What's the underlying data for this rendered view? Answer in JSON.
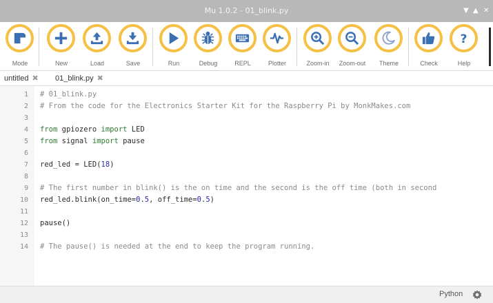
{
  "window": {
    "title": "Mu 1.0.2 - 01_blink.py"
  },
  "toolbar": {
    "buttons": [
      {
        "label": "Mode"
      },
      {
        "label": "New"
      },
      {
        "label": "Load"
      },
      {
        "label": "Save"
      },
      {
        "label": "Run"
      },
      {
        "label": "Debug"
      },
      {
        "label": "REPL"
      },
      {
        "label": "Plotter"
      },
      {
        "label": "Zoom-in"
      },
      {
        "label": "Zoom-out"
      },
      {
        "label": "Theme"
      },
      {
        "label": "Check"
      },
      {
        "label": "Help"
      }
    ]
  },
  "tabs": [
    {
      "label": "untitled"
    },
    {
      "label": "01_blink.py"
    }
  ],
  "editor": {
    "lines": [
      {
        "num": "1",
        "code": "# 01_blink.py"
      },
      {
        "num": "2",
        "code": "# From the code for the Electronics Starter Kit for the Raspberry Pi by MonkMakes.com"
      },
      {
        "num": "3",
        "code": ""
      },
      {
        "num": "4",
        "code": "from gpiozero import LED"
      },
      {
        "num": "5",
        "code": "from signal import pause"
      },
      {
        "num": "6",
        "code": ""
      },
      {
        "num": "7",
        "code": "red_led = LED(18)"
      },
      {
        "num": "8",
        "code": ""
      },
      {
        "num": "9",
        "code": "# The first number in blink() is the on time and the second is the off time (both in second"
      },
      {
        "num": "10",
        "code": "red_led.blink(on_time=0.5, off_time=0.5)"
      },
      {
        "num": "11",
        "code": ""
      },
      {
        "num": "12",
        "code": "pause()"
      },
      {
        "num": "13",
        "code": ""
      },
      {
        "num": "14",
        "code": "# The pause() is needed at the end to keep the program running."
      }
    ]
  },
  "status": {
    "mode": "Python"
  },
  "colors": {
    "accent": "#f5c043",
    "icon": "#3b6fb4",
    "titlebar": "#b8b8b8"
  }
}
